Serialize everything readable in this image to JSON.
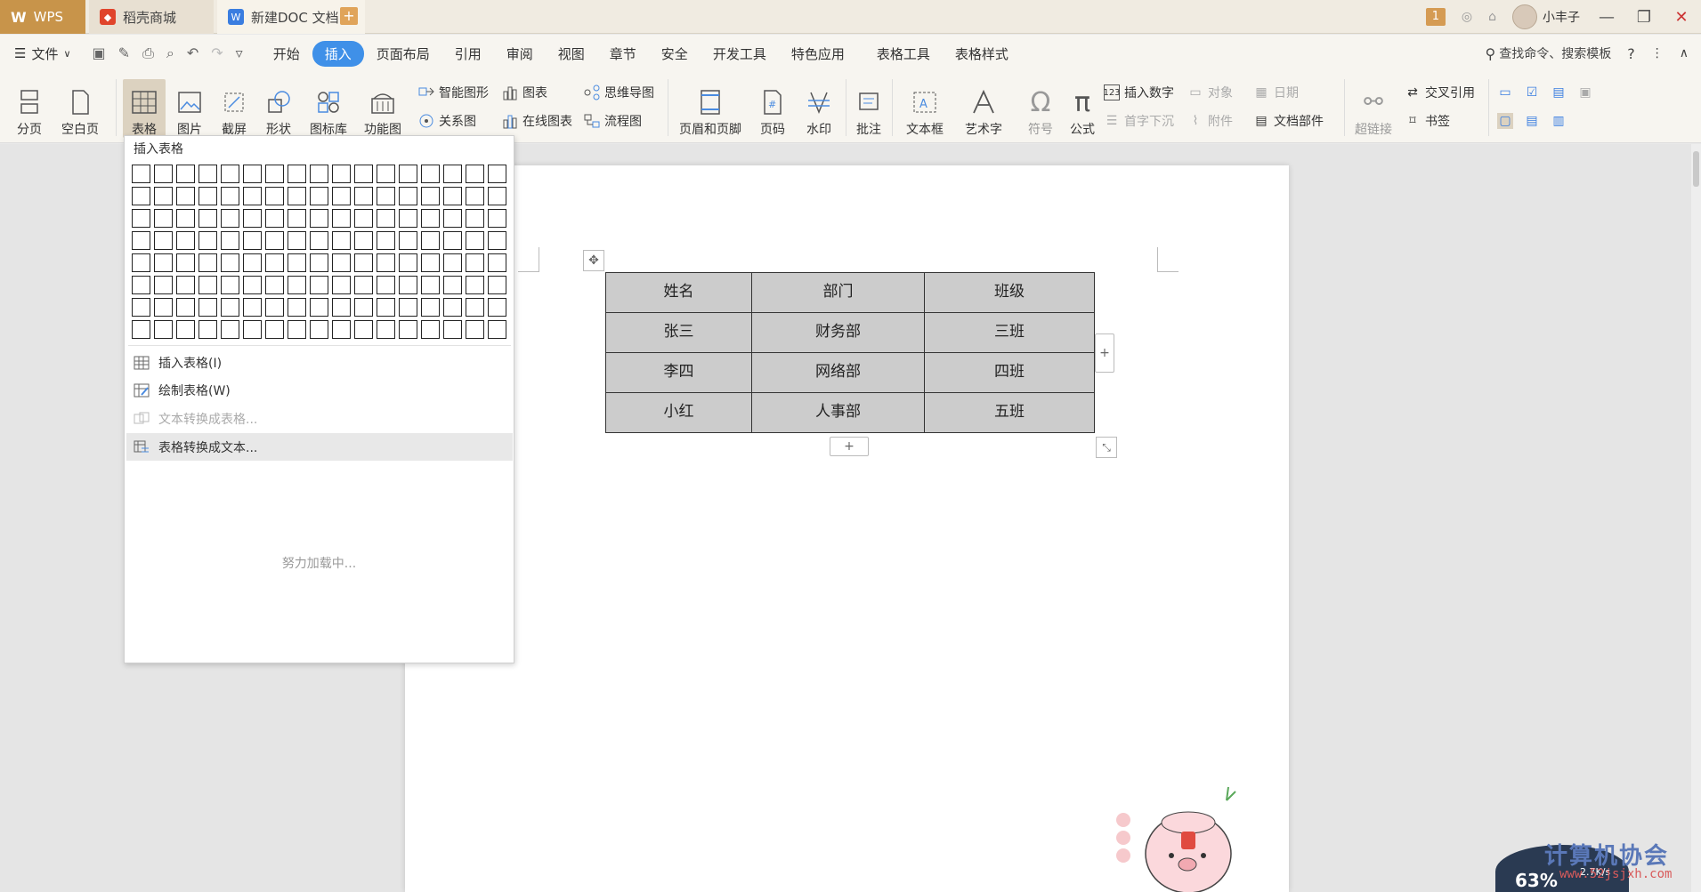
{
  "titlebar": {
    "tabs": [
      {
        "label": "WPS"
      },
      {
        "label": "稻壳商城"
      },
      {
        "label": "新建DOC 文档."
      }
    ],
    "badge": "1",
    "user": "小丰子"
  },
  "menubar": {
    "file": "文件",
    "items": [
      "开始",
      "插入",
      "页面布局",
      "引用",
      "审阅",
      "视图",
      "章节",
      "安全",
      "开发工具",
      "特色应用",
      "表格工具",
      "表格样式"
    ],
    "active": "插入",
    "search": "查找命令、搜索模板"
  },
  "ribbon": {
    "page_break": "分页",
    "blank_page": "空白页",
    "table": "表格",
    "picture": "图片",
    "screenshot": "截屏",
    "shapes": "形状",
    "icon_library": "图标库",
    "function_chart": "功能图",
    "smart_shape": "智能图形",
    "chart": "图表",
    "relation_chart": "关系图",
    "online_chart": "在线图表",
    "mind_map": "思维导图",
    "flowchart": "流程图",
    "header_footer": "页眉和页脚",
    "page_number": "页码",
    "watermark": "水印",
    "comment": "批注",
    "textbox": "文本框",
    "wordart": "艺术字",
    "symbol": "符号",
    "formula": "公式",
    "insert_number": "插入数字",
    "object": "对象",
    "date": "日期",
    "dropcap": "首字下沉",
    "attachment": "附件",
    "doc_parts": "文档部件",
    "hyperlink": "超链接",
    "cross_ref": "交叉引用",
    "bookmark": "书签"
  },
  "dropdown": {
    "title": "插入表格",
    "grid_rows": 8,
    "grid_cols": 17,
    "items": [
      {
        "label": "插入表格(I)",
        "disabled": false
      },
      {
        "label": "绘制表格(W)",
        "disabled": false
      },
      {
        "label": "文本转换成表格...",
        "disabled": true
      },
      {
        "label": "表格转换成文本...",
        "disabled": false
      }
    ],
    "loading": "努力加载中..."
  },
  "document": {
    "table": [
      [
        "姓名",
        "部门",
        "班级"
      ],
      [
        "张三",
        "财务部",
        "三班"
      ],
      [
        "李四",
        "网络部",
        "四班"
      ],
      [
        "小红",
        "人事部",
        "五班"
      ]
    ],
    "add_symbol": "+"
  },
  "overlay": {
    "watermark": "计算机协会",
    "watermark_url": "www.52jsjxh.com",
    "cpu_percent": "63%",
    "net_speed": "2.7K/s"
  }
}
